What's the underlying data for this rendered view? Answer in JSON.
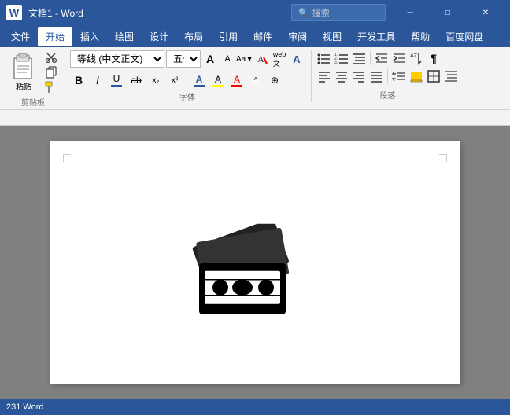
{
  "titlebar": {
    "logo": "W",
    "title": "文档1 - Word",
    "search_placeholder": "搜索",
    "min_label": "─",
    "max_label": "□",
    "close_label": "✕"
  },
  "menubar": {
    "items": [
      {
        "label": "文件",
        "active": false
      },
      {
        "label": "开始",
        "active": true
      },
      {
        "label": "插入",
        "active": false
      },
      {
        "label": "绘图",
        "active": false
      },
      {
        "label": "设计",
        "active": false
      },
      {
        "label": "布局",
        "active": false
      },
      {
        "label": "引用",
        "active": false
      },
      {
        "label": "邮件",
        "active": false
      },
      {
        "label": "审阅",
        "active": false
      },
      {
        "label": "视图",
        "active": false
      },
      {
        "label": "开发工具",
        "active": false
      },
      {
        "label": "帮助",
        "active": false
      },
      {
        "label": "百度网盘",
        "active": false
      }
    ]
  },
  "ribbon": {
    "clipboard": {
      "paste_label": "粘贴",
      "cut_label": "✂",
      "copy_label": "⿻",
      "format_label": "⌄",
      "group_label": "剪贴板"
    },
    "font": {
      "name": "等线 (中文正文)",
      "size": "五号",
      "grow_label": "A",
      "shrink_label": "A",
      "case_label": "Aa",
      "clear_label": "A",
      "bold_label": "B",
      "italic_label": "I",
      "underline_label": "U",
      "strikethrough_label": "ab",
      "subscript_label": "x₂",
      "superscript_label": "x²",
      "font_color_label": "A",
      "highlight_label": "A",
      "font_color2_label": "A",
      "char_label": "A",
      "phonetic_label": "⊕",
      "group_label": "字体"
    },
    "paragraph": {
      "group_label": "段落"
    }
  },
  "statusbar": {
    "word_count": "231 Word"
  },
  "document": {
    "content": ""
  }
}
